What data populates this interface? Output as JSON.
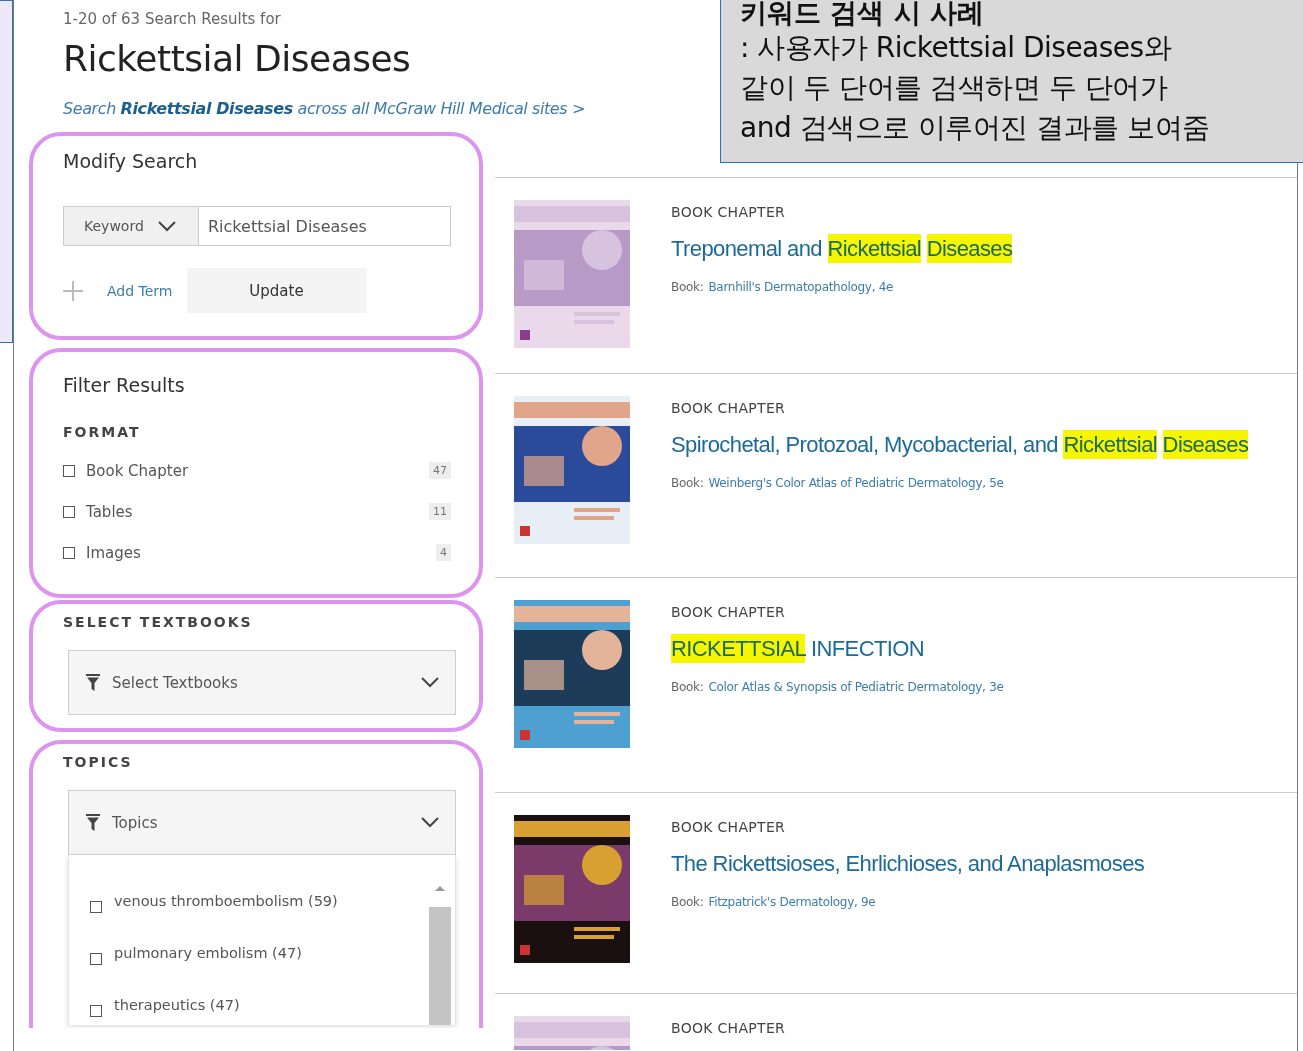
{
  "annotation": {
    "title": "키워드 검색 시 사례",
    "lines": [
      ": 사용자가 Rickettsial Diseases와",
      "같이 두 단어를 검색하면 두 단어가",
      "and 검색으로 이루어진 결과를 보여줌"
    ]
  },
  "results_summary": "1-20 of 63 Search Results for",
  "query_title": "Rickettsial Diseases",
  "cross_site_link": "Search **Rickettsial Diseases** across all McGraw Hill Medical sites >",
  "modify_search": {
    "heading": "Modify Search",
    "field_type": "Keyword",
    "value": "Rickettsial Diseases",
    "add_term": "Add Term",
    "update_button": "Update"
  },
  "filter_results": {
    "heading": "Filter Results",
    "format_heading": "FORMAT",
    "options": [
      {
        "label": "Book Chapter",
        "count": "47",
        "checked": false
      },
      {
        "label": "Tables",
        "count": "11",
        "checked": false
      },
      {
        "label": "Images",
        "count": "4",
        "checked": false
      }
    ]
  },
  "textbooks": {
    "heading": "SELECT TEXTBOOKS",
    "placeholder": "Select Textbooks"
  },
  "topics": {
    "heading": "TOPICS",
    "placeholder": "Topics",
    "options": [
      {
        "label": "venous thromboembolism (59)",
        "checked": false
      },
      {
        "label": "pulmonary embolism (47)",
        "checked": false
      },
      {
        "label": "therapeutics (47)",
        "checked": false
      }
    ]
  },
  "results": [
    {
      "type": "BOOK CHAPTER",
      "title": [
        {
          "text": "Treponemal and ",
          "highlighted": false
        },
        {
          "text": "Rickettsial",
          "highlighted": true
        },
        {
          "text": "Diseases",
          "highlighted": true
        }
      ],
      "book_label": "Book:",
      "book": "Barnhill's Dermatopathology, 4e"
    },
    {
      "type": "BOOK CHAPTER",
      "title": [
        {
          "text": "Spirochetal, Protozoal, Mycobacterial, and ",
          "highlighted": false
        },
        {
          "text": "Rickettsial",
          "highlighted": true
        },
        {
          "text": "Diseases",
          "highlighted": true
        }
      ],
      "book_label": "Book:",
      "book": "Weinberg's Color Atlas of Pediatric Dermatology, 5e"
    },
    {
      "type": "BOOK CHAPTER",
      "title": [
        {
          "text": "RICKETTSIAL",
          "highlighted": true
        },
        {
          "text": " INFECTION",
          "highlighted": false
        }
      ],
      "book_label": "Book:",
      "book": "Color Atlas & Synopsis of Pediatric Dermatology, 3e"
    },
    {
      "type": "BOOK CHAPTER",
      "title": [
        {
          "text": "The Rickettsioses, Ehrlichioses, and Anaplasmoses",
          "highlighted": false
        }
      ],
      "book_label": "Book:",
      "book": "Fitzpatrick's Dermatology, 9e"
    },
    {
      "type": "BOOK CHAPTER"
    }
  ]
}
